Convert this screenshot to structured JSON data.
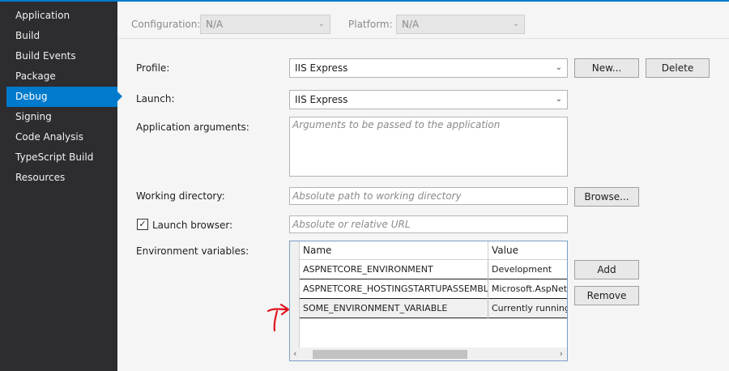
{
  "sidebar": {
    "items": [
      {
        "label": "Application"
      },
      {
        "label": "Build"
      },
      {
        "label": "Build Events"
      },
      {
        "label": "Package"
      },
      {
        "label": "Debug",
        "active": true
      },
      {
        "label": "Signing"
      },
      {
        "label": "Code Analysis"
      },
      {
        "label": "TypeScript Build"
      },
      {
        "label": "Resources"
      }
    ]
  },
  "configbar": {
    "configuration_label": "Configuration:",
    "configuration_value": "N/A",
    "platform_label": "Platform:",
    "platform_value": "N/A"
  },
  "form": {
    "profile_label": "Profile:",
    "profile_value": "IIS Express",
    "new_label": "New...",
    "delete_label": "Delete",
    "launch_label": "Launch:",
    "launch_value": "IIS Express",
    "args_label": "Application arguments:",
    "args_placeholder": "Arguments to be passed to the application",
    "workdir_label": "Working directory:",
    "workdir_placeholder": "Absolute path to working directory",
    "browse_label": "Browse...",
    "launch_browser_label": "Launch browser:",
    "launch_browser_checked": true,
    "url_placeholder": "Absolute or relative URL",
    "env_label": "Environment variables:",
    "add_label": "Add",
    "remove_label": "Remove"
  },
  "env_grid": {
    "columns": [
      "Name",
      "Value"
    ],
    "rows": [
      {
        "name": "ASPNETCORE_ENVIRONMENT",
        "value": "Development"
      },
      {
        "name": "ASPNETCORE_HOSTINGSTARTUPASSEMBLIES",
        "value": "Microsoft.AspNetC"
      },
      {
        "name": "SOME_ENVIRONMENT_VARIABLE",
        "value": "Currently running"
      }
    ]
  },
  "colors": {
    "accent": "#007acc",
    "sidebar_bg": "#2d2d30",
    "annotation": "#e0141e"
  }
}
